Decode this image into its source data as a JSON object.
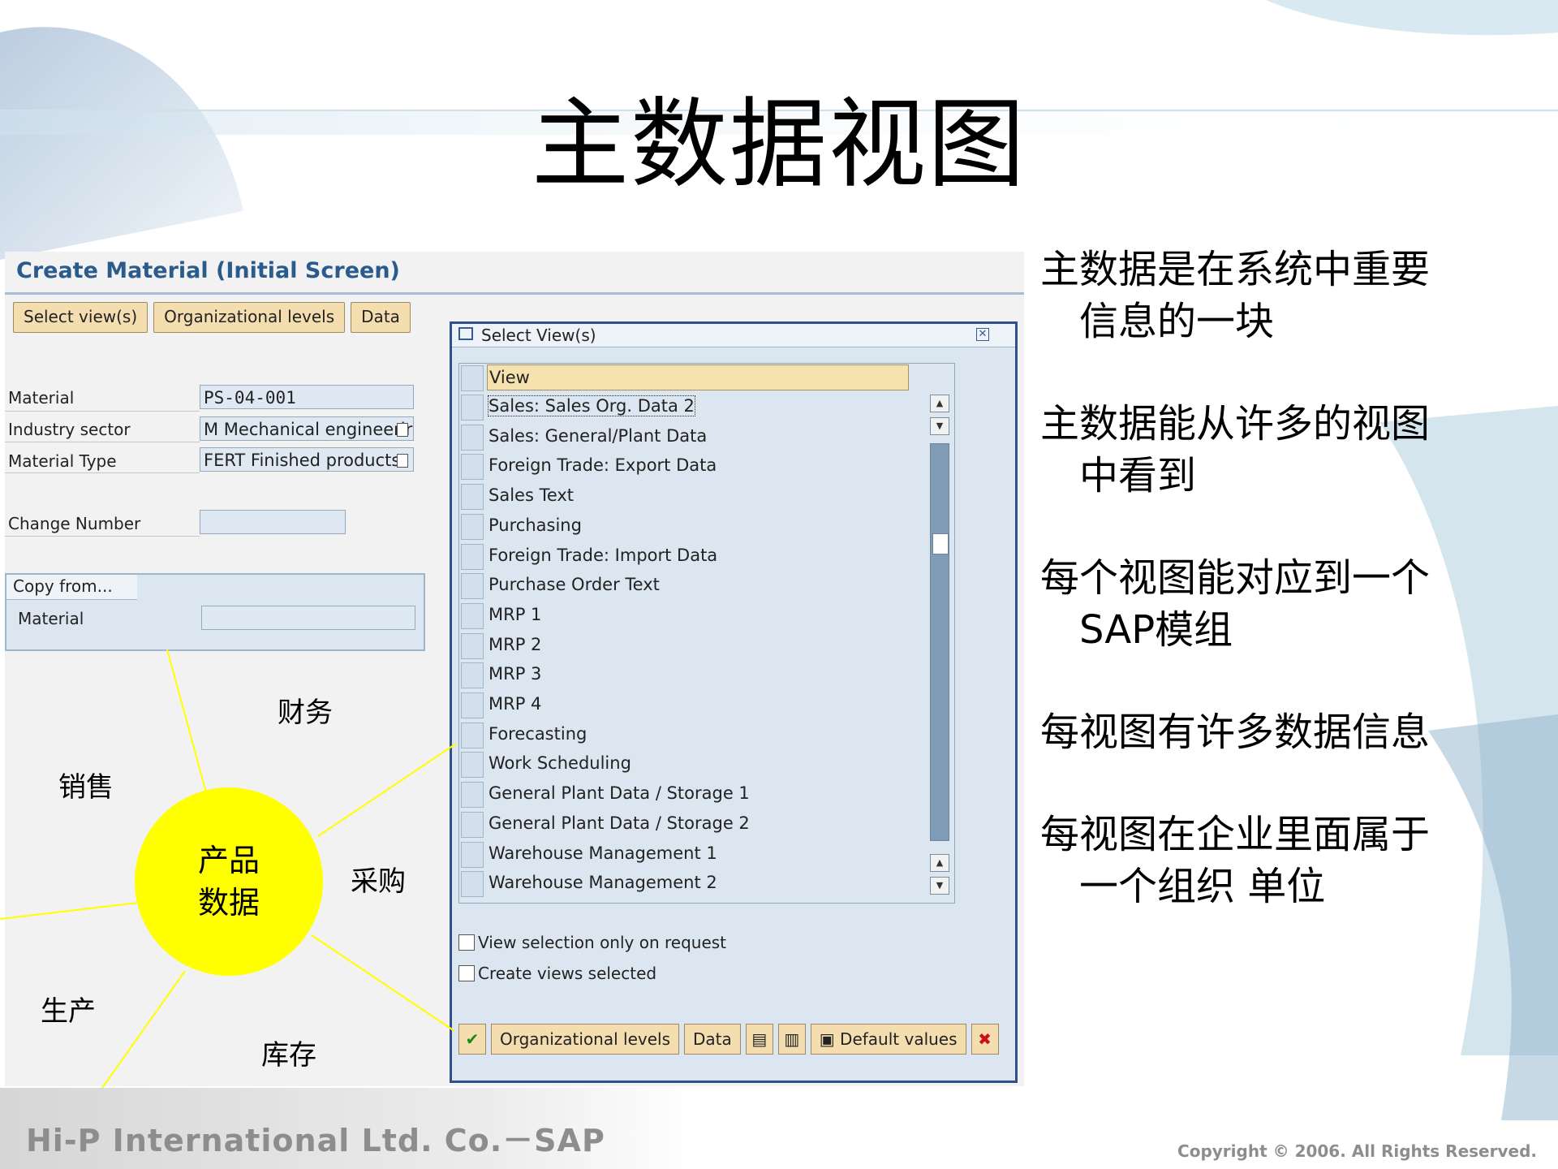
{
  "slide": {
    "title": "主数据视图",
    "footer": "Hi-P International Ltd. Co.－SAP",
    "copyright": "Copyright © 2006. All Rights Reserved."
  },
  "sap": {
    "screen_title": "Create Material (Initial Screen)",
    "toolbar": [
      "Select view(s)",
      "Organizational levels",
      "Data"
    ],
    "fields": {
      "material_label": "Material",
      "material_value": "PS-04-001",
      "industry_label": "Industry sector",
      "industry_value": "M Mechanical engineerir",
      "mattype_label": "Material Type",
      "mattype_value": "FERT Finished products",
      "change_label": "Change Number",
      "change_value": ""
    },
    "copy_from": {
      "tab": "Copy from...",
      "material_label": "Material",
      "material_value": ""
    }
  },
  "dialog": {
    "title": "Select View(s)",
    "column_header": "View",
    "views": [
      "Sales: Sales Org. Data 2",
      "Sales: General/Plant Data",
      "Foreign Trade: Export Data",
      "Sales Text",
      "Purchasing",
      "Foreign Trade: Import Data",
      "Purchase Order Text",
      "MRP 1",
      "MRP 2",
      "MRP 3",
      "MRP 4",
      "Forecasting",
      "Work Scheduling",
      "General Plant Data / Storage 1",
      "General Plant Data / Storage 2",
      "Warehouse Management 1",
      "Warehouse Management 2"
    ],
    "checkboxes": [
      "View selection only on request",
      "Create views selected"
    ],
    "footer_buttons": {
      "org_levels": "Organizational levels",
      "data": "Data",
      "defaults": "Default values"
    }
  },
  "diagram": {
    "hub_line1": "产品",
    "hub_line2": "数据",
    "labels": {
      "finance": "财务",
      "sales": "销售",
      "purchasing": "采购",
      "production": "生产",
      "inventory": "库存"
    }
  },
  "bullets": [
    {
      "line1": "主数据是在系统中重要",
      "line2": "信息的一块"
    },
    {
      "line1": "主数据能从许多的视图",
      "line2": "中看到"
    },
    {
      "line1": "每个视图能对应到一个",
      "line2": "SAP模组"
    },
    {
      "line1": "每视图有许多数据信息",
      "line2": ""
    },
    {
      "line1": "每视图在企业里面属于",
      "line2": "一个组织 单位"
    }
  ],
  "colors": {
    "hub": "#ffff00",
    "sap_button": "#f4deb0",
    "sap_title": "#2a5b8c",
    "dialog_border": "#2f4f8f"
  }
}
